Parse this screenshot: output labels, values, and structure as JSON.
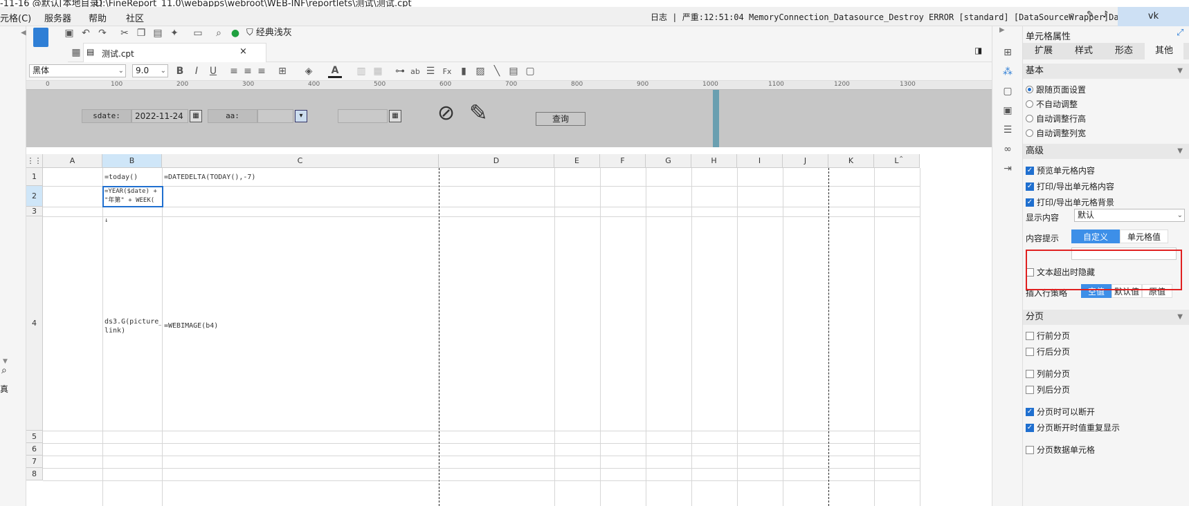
{
  "titlebar": {
    "left": "-11-16 @默认[本地目录]",
    "path": "D:\\FineReport_11.0\\webapps\\webroot\\WEB-INF\\reportlets\\测试\\测试.cpt"
  },
  "menu": [
    "元格(C)",
    "服务器",
    "帮助",
    "社区"
  ],
  "log": {
    "label": "日志",
    "sep": "|",
    "text": "严重:12:51:04 MemoryConnection_Datasource_Destroy ERROR [standard] [DataSourceWrapper]Data..."
  },
  "user": "vk",
  "toolbar": {
    "theme_label": "经典浅灰"
  },
  "file_tab": {
    "name": "测试.cpt"
  },
  "format": {
    "font": "黑体",
    "size": "9.0"
  },
  "ruler_ticks": [
    "0",
    "100",
    "200",
    "300",
    "400",
    "500",
    "600",
    "700",
    "800",
    "900",
    "1000",
    "1100",
    "1200",
    "1300"
  ],
  "params": {
    "sdate_label": "sdate:",
    "sdate_value": "2022-11-24",
    "aa_label": "aa:",
    "query_button": "查询"
  },
  "columns": [
    "A",
    "B",
    "C",
    "D",
    "E",
    "F",
    "G",
    "H",
    "I",
    "J",
    "K",
    "L"
  ],
  "rows": [
    "1",
    "2",
    "3",
    "4",
    "5",
    "6",
    "7",
    "8"
  ],
  "cells": {
    "B1": "=today()",
    "C1": "=DATEDELTA(TODAY(),-7)",
    "B2": "=YEAR($date) +\n\"年第\" + WEEK(",
    "B3": "↓",
    "B4": "ds3.G(picture_\nlink)",
    "C4": "=WEBIMAGE(b4)"
  },
  "panel": {
    "title": "单元格属性",
    "tabs": [
      "扩展",
      "样式",
      "形态",
      "其他"
    ],
    "basic": {
      "header": "基本",
      "options": [
        "跟随页面设置",
        "不自动调整",
        "自动调整行高",
        "自动调整列宽"
      ]
    },
    "advanced": {
      "header": "高级",
      "checks": [
        "预览单元格内容",
        "打印/导出单元格内容",
        "打印/导出单元格背景"
      ],
      "display_label": "显示内容",
      "display_value": "默认",
      "tip_label": "内容提示",
      "tip_options": [
        "自定义",
        "单元格值"
      ],
      "overflow_hide": "文本超出时隐藏",
      "insert_label": "插入行策略",
      "insert_options": [
        "空值",
        "默认值",
        "原值"
      ]
    },
    "paging": {
      "header": "分页",
      "checks": [
        "行前分页",
        "行后分页",
        "列前分页",
        "列后分页",
        "分页时可以断开",
        "分页断开时值重复显示",
        "分页数据单元格"
      ]
    }
  },
  "left": {
    "label": "真"
  }
}
